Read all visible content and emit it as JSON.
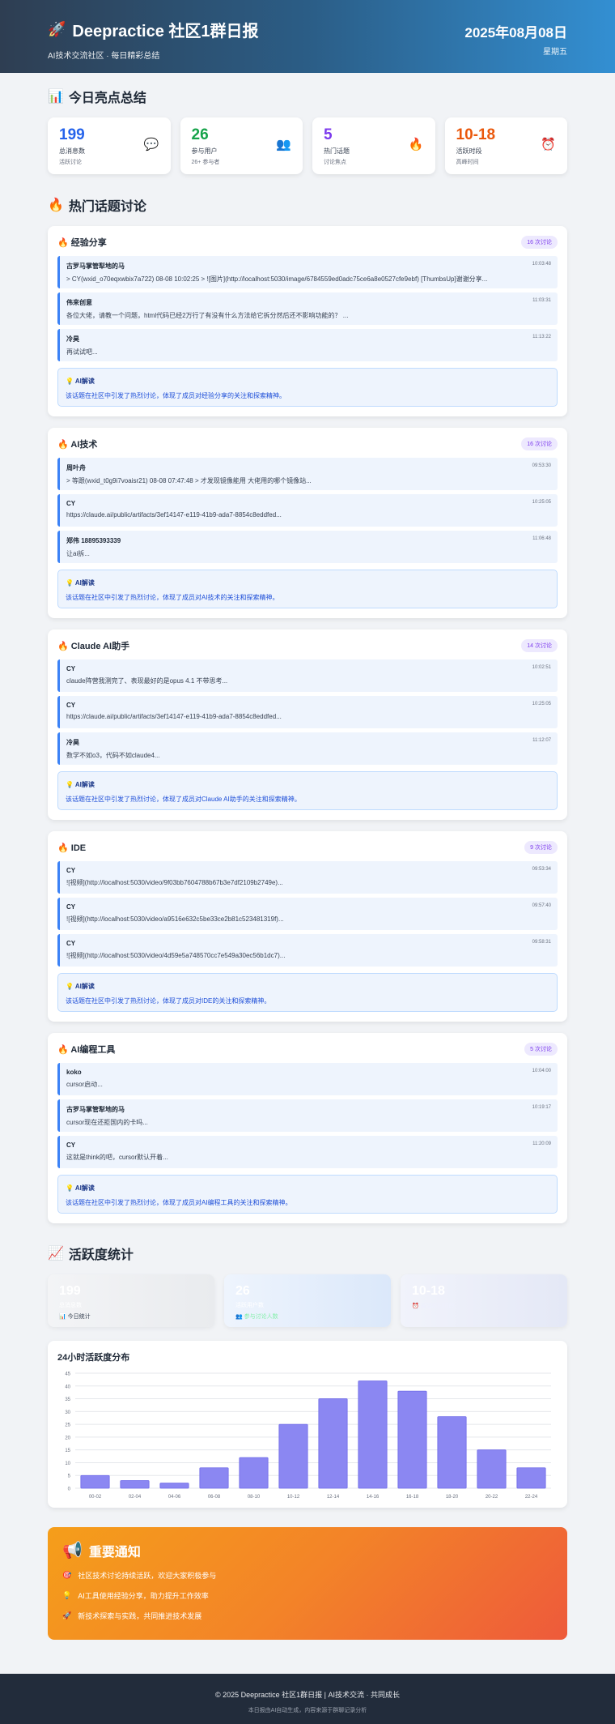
{
  "header": {
    "title": "Deepractice 社区1群日报",
    "subtitle": "AI技术交流社区 · 每日精彩总结",
    "date": "2025年08月08日",
    "weekday": "星期五"
  },
  "summary": {
    "title": "今日亮点总结",
    "cards": [
      {
        "value": "199",
        "label": "总消息数",
        "sub": "活跃讨论",
        "icon": "💬"
      },
      {
        "value": "26",
        "label": "参与用户",
        "sub": "26+ 参与者",
        "icon": "👥"
      },
      {
        "value": "5",
        "label": "热门话题",
        "sub": "讨论焦点",
        "icon": "🔥"
      },
      {
        "value": "10-18",
        "label": "活跃时段",
        "sub": "高峰时间",
        "icon": "⏰"
      }
    ]
  },
  "topics_title": "热门话题讨论",
  "topics": [
    {
      "name": "经验分享",
      "badge": "16 次讨论",
      "messages": [
        {
          "user": "古罗马掌管犁地的马",
          "text": "> CY(wxid_o70eqxwbix7a722) 08-08 10:02:25 > ![图片](http://localhost:5030/image/6784559ed0adc75ce6a8e0527cfe9ebf) [ThumbsUp]谢谢分享...",
          "time": "10:03:48"
        },
        {
          "user": "伟来创意",
          "text": "各位大佬，请教一个问题，html代码已经2万行了有没有什么方法给它拆分然后还不影响功能的？ ...",
          "time": "11:03:31"
        },
        {
          "user": "冷昊",
          "text": "再试试吧...",
          "time": "11:13:22"
        }
      ],
      "ai_title": "AI解读",
      "ai_text": "该话题在社区中引发了热烈讨论，体现了成员对经验分享的关注和探索精神。"
    },
    {
      "name": "AI技术",
      "badge": "16 次讨论",
      "messages": [
        {
          "user": "周叶舟",
          "text": "> 等跟(wxid_t0g9i7voaisr21) 08-08 07:47:48 > 才发现镜像能用 大佬用的哪个镜像站...",
          "time": "09:53:30"
        },
        {
          "user": "CY",
          "text": "https://claude.ai/public/artifacts/3ef14147-e119-41b9-ada7-8854c8eddfed...",
          "time": "10:25:05"
        },
        {
          "user": "郑伟 18895393339",
          "text": "让ai拆...",
          "time": "11:06:48"
        }
      ],
      "ai_title": "AI解读",
      "ai_text": "该话题在社区中引发了热烈讨论，体现了成员对AI技术的关注和探索精神。"
    },
    {
      "name": "Claude AI助手",
      "badge": "14 次讨论",
      "messages": [
        {
          "user": "CY",
          "text": "claude阵营我测完了、表现最好的是opus 4.1 不带思考...",
          "time": "10:02:51"
        },
        {
          "user": "CY",
          "text": "https://claude.ai/public/artifacts/3ef14147-e119-41b9-ada7-8854c8eddfed...",
          "time": "10:25:05"
        },
        {
          "user": "冷昊",
          "text": "数学不如o3，代码不如claude4...",
          "time": "11:12:07"
        }
      ],
      "ai_title": "AI解读",
      "ai_text": "该话题在社区中引发了热烈讨论，体现了成员对Claude AI助手的关注和探索精神。"
    },
    {
      "name": "IDE",
      "badge": "9 次讨论",
      "messages": [
        {
          "user": "CY",
          "text": "![视频](http://localhost:5030/video/9f03bb7604788b67b3e7df2109b2749e)...",
          "time": "09:53:34"
        },
        {
          "user": "CY",
          "text": "![视频](http://localhost:5030/video/a9516e632c5be33ce2b81c523481319f)...",
          "time": "09:57:40"
        },
        {
          "user": "CY",
          "text": "![视频](http://localhost:5030/video/4d59e5a748570cc7e549a30ec56b1dc7)...",
          "time": "09:58:31"
        }
      ],
      "ai_title": "AI解读",
      "ai_text": "该话题在社区中引发了热烈讨论，体现了成员对IDE的关注和探索精神。"
    },
    {
      "name": "AI编程工具",
      "badge": "5 次讨论",
      "messages": [
        {
          "user": "koko",
          "text": "cursor启动...",
          "time": "10:04:00"
        },
        {
          "user": "古罗马掌管犁地的马",
          "text": "cursor现在还拒国内的卡吗...",
          "time": "10:19:17"
        },
        {
          "user": "CY",
          "text": "这就是think的吧，cursor默认开着...",
          "time": "11:20:09"
        }
      ],
      "ai_title": "AI解读",
      "ai_text": "该话题在社区中引发了热烈讨论，体现了成员对AI编程工具的关注和探索精神。"
    }
  ],
  "activity": {
    "title": "活跃度统计",
    "cards": [
      {
        "value": "199",
        "label": "总消息数",
        "sub": "今日统计",
        "icon": "📊",
        "sub_color": "#374151"
      },
      {
        "value": "26",
        "label": "活跃用户数",
        "sub": "参与讨论人数",
        "icon": "👥",
        "sub_color": "#86efac"
      },
      {
        "value": "10-18",
        "label": "",
        "sub": "最活跃时间段",
        "icon": "⏰",
        "sub_color": "#f3f4ff"
      }
    ]
  },
  "chart_data": {
    "type": "bar",
    "title": "24小时活跃度分布",
    "categories": [
      "00-02",
      "02-04",
      "04-06",
      "06-08",
      "08-10",
      "10-12",
      "12-14",
      "14-16",
      "16-18",
      "18-20",
      "20-22",
      "22-24"
    ],
    "values": [
      5,
      3,
      2,
      8,
      12,
      25,
      35,
      42,
      38,
      28,
      15,
      8
    ],
    "ylim": [
      0,
      45
    ],
    "yticks": [
      0,
      5,
      10,
      15,
      20,
      25,
      30,
      35,
      40,
      45
    ],
    "grid": true,
    "bar_color": "#8b87f2"
  },
  "notice": {
    "title": "重要通知",
    "items": [
      {
        "icon": "🎯",
        "text": "社区技术讨论持续活跃，欢迎大家积极参与"
      },
      {
        "icon": "💡",
        "text": "AI工具使用经验分享，助力提升工作效率"
      },
      {
        "icon": "🚀",
        "text": "新技术探索与实践，共同推进技术发展"
      }
    ]
  },
  "footer": {
    "line1": "© 2025 Deepractice 社区1群日报 | AI技术交流 · 共同成长",
    "line2": "本日报由AI自动生成，内容来源于群聊记录分析"
  }
}
